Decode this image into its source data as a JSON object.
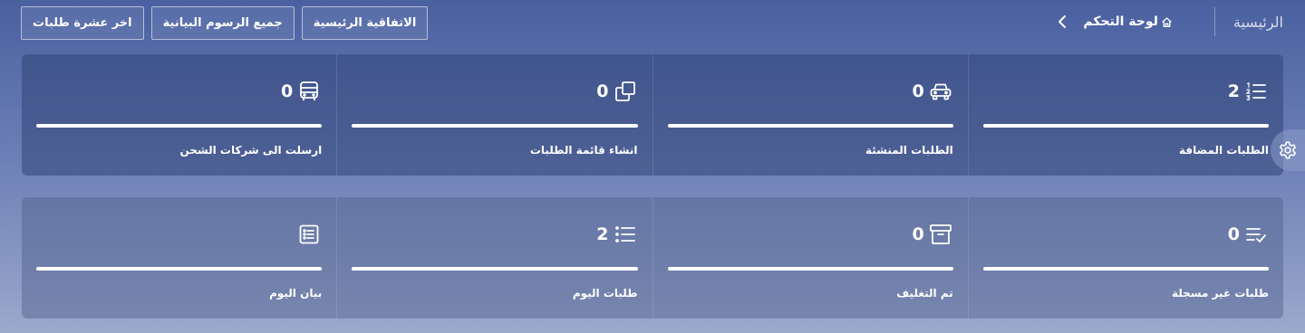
{
  "header": {
    "buttons": [
      {
        "label": "الاتفاقية الرئيسية"
      },
      {
        "label": "جميع الرسوم البيانية"
      },
      {
        "label": "اخر عشرة طلبات"
      }
    ],
    "breadcrumb": {
      "home": "الرئيسية",
      "dashboard": "لوحة التحكم"
    }
  },
  "panel1": {
    "cards": [
      {
        "value": "2",
        "label": "الطلبات المضافة",
        "icon": "list-numbered-icon",
        "progress": 1.0
      },
      {
        "value": "0",
        "label": "الطلبات المنشئة",
        "icon": "car-icon",
        "progress": 1.0
      },
      {
        "value": "0",
        "label": "انشاء قائمة الطلبات",
        "icon": "copy-icon",
        "progress": 1.0
      },
      {
        "value": "0",
        "label": "ارسلت الى شركات الشحن",
        "icon": "bus-icon",
        "progress": 1.0
      }
    ]
  },
  "panel2": {
    "cards": [
      {
        "value": "0",
        "label": "طلبات غير مسجلة",
        "icon": "list-check-icon",
        "progress": 1.0
      },
      {
        "value": "0",
        "label": "تم التغليف",
        "icon": "archive-box-icon",
        "progress": 1.0
      },
      {
        "value": "2",
        "label": "طلبات اليوم",
        "icon": "list-icon",
        "progress": 1.0
      },
      {
        "value": "",
        "label": "بيان اليوم",
        "icon": "list-box-icon",
        "progress": 1.0
      }
    ]
  },
  "colors": {
    "background_top": "#4a60a0",
    "background_bottom": "#9ba9cc",
    "text": "#ffffff"
  }
}
